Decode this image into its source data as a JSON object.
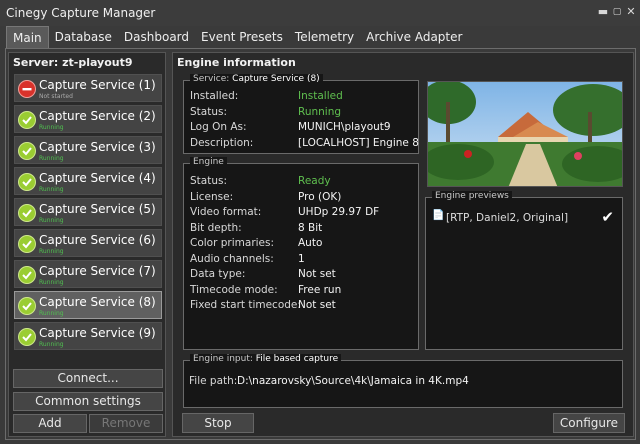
{
  "window": {
    "title": "Cinegy Capture Manager"
  },
  "tabs": [
    "Main",
    "Database",
    "Dashboard",
    "Event Presets",
    "Telemetry",
    "Archive Adapter"
  ],
  "server": {
    "label": "Server: zt-playout9"
  },
  "services": [
    {
      "name": "Capture Service (1)",
      "status": "Not started",
      "state": "stop"
    },
    {
      "name": "Capture Service (2)",
      "status": "Running",
      "state": "ok"
    },
    {
      "name": "Capture Service (3)",
      "status": "Running",
      "state": "ok"
    },
    {
      "name": "Capture Service (4)",
      "status": "Running",
      "state": "ok"
    },
    {
      "name": "Capture Service (5)",
      "status": "Running",
      "state": "ok"
    },
    {
      "name": "Capture Service (6)",
      "status": "Running",
      "state": "ok"
    },
    {
      "name": "Capture Service (7)",
      "status": "Running",
      "state": "ok"
    },
    {
      "name": "Capture Service (8)",
      "status": "Running",
      "state": "ok"
    },
    {
      "name": "Capture Service (9)",
      "status": "Running",
      "state": "ok"
    }
  ],
  "selected_service_index": 7,
  "left_buttons": {
    "connect": "Connect...",
    "common": "Common settings",
    "add": "Add",
    "remove": "Remove"
  },
  "engine_info": {
    "header": "Engine information",
    "service_group": {
      "legend": "Service:",
      "legend_value": "Capture Service (8)",
      "rows": [
        {
          "k": "Installed:",
          "v": "Installed",
          "green": true
        },
        {
          "k": "Status:",
          "v": "Running",
          "green": true
        },
        {
          "k": "Log On As:",
          "v": "MUNICH\\playout9",
          "green": false
        },
        {
          "k": "Description:",
          "v": "[LOCALHOST] Engine 8",
          "green": false
        }
      ]
    },
    "engine_group": {
      "legend": "Engine",
      "rows": [
        {
          "k": "Status:",
          "v": "Ready",
          "green": true
        },
        {
          "k": "License:",
          "v": "Pro (OK)",
          "green": false
        },
        {
          "k": "Video format:",
          "v": "UHDp 29.97 DF",
          "green": false
        },
        {
          "k": "Bit depth:",
          "v": "8 Bit",
          "green": false
        },
        {
          "k": "Color primaries:",
          "v": "Auto",
          "green": false
        },
        {
          "k": "Audio channels:",
          "v": "1",
          "green": false
        },
        {
          "k": "Data type:",
          "v": "Not set",
          "green": false
        },
        {
          "k": "Timecode mode:",
          "v": "Free run",
          "green": false
        },
        {
          "k": "Fixed start timecode:",
          "v": "Not set",
          "green": false
        }
      ]
    },
    "previews_group": {
      "legend": "Engine previews",
      "item": "[RTP, Daniel2, Original]"
    },
    "input_group": {
      "legend": "Engine input:",
      "legend_value": "File based capture",
      "file_label": "File path:",
      "file_path": "D:\\nazarovsky\\Source\\4k\\Jamaica in 4K.mp4"
    },
    "stop_label": "Stop",
    "configure_label": "Configure"
  },
  "colors": {
    "running": "#5fbf4f",
    "error": "#d9322b",
    "ok_icon": "#9acd32"
  }
}
